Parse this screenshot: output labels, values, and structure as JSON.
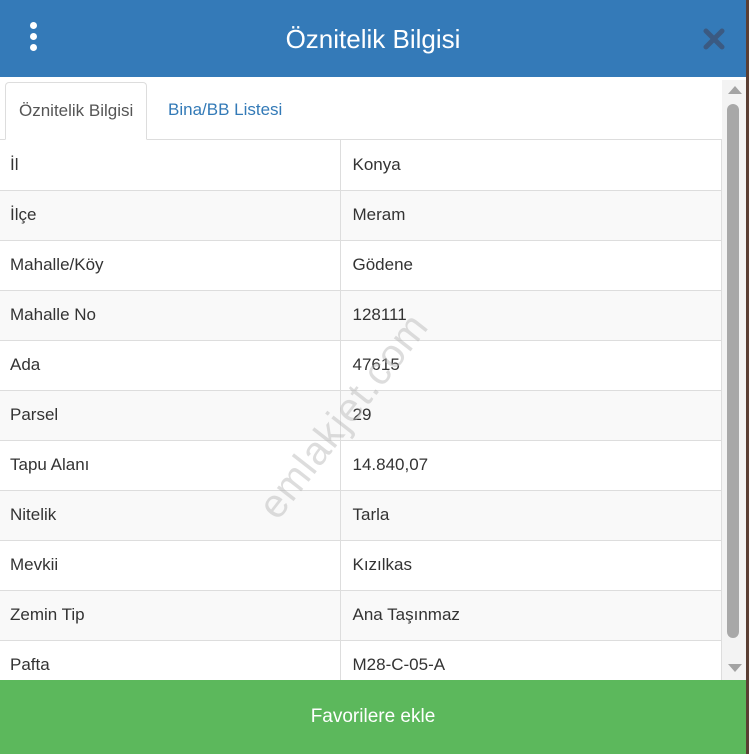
{
  "header": {
    "title": "Öznitelik Bilgisi",
    "bg_color": "#347ab8",
    "menu_icon": "vertical-dots-icon",
    "close_icon": "close-icon"
  },
  "tabs": [
    {
      "label": "Öznitelik Bilgisi",
      "active": true
    },
    {
      "label": "Bina/BB Listesi",
      "active": false
    }
  ],
  "rows": [
    {
      "key": "İl",
      "value": "Konya"
    },
    {
      "key": "İlçe",
      "value": "Meram"
    },
    {
      "key": "Mahalle/Köy",
      "value": "Gödene"
    },
    {
      "key": "Mahalle No",
      "value": "128111"
    },
    {
      "key": "Ada",
      "value": "47615"
    },
    {
      "key": "Parsel",
      "value": "29"
    },
    {
      "key": "Tapu Alanı",
      "value": "14.840,07"
    },
    {
      "key": "Nitelik",
      "value": "Tarla"
    },
    {
      "key": "Mevkii",
      "value": "Kızılkas"
    },
    {
      "key": "Zemin Tip",
      "value": "Ana Taşınmaz"
    },
    {
      "key": "Pafta",
      "value": "M28-C-05-A"
    }
  ],
  "watermark": "emlakjet.com",
  "footer": {
    "button_label": "Favorilere ekle",
    "bg_color": "#5cb85c"
  }
}
